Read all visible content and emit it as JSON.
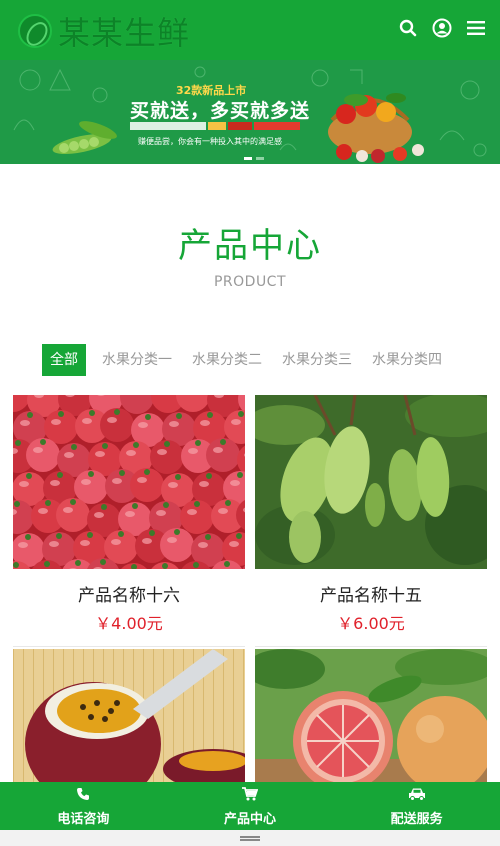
{
  "header": {
    "logo_text": "某某生鲜",
    "icons": [
      "search-icon",
      "user-icon",
      "menu-icon"
    ],
    "bg_color": "#16a637"
  },
  "banner": {
    "subtitle": "32款新品上市",
    "title": "买就送，多买就多送",
    "note": "赚便品尝，你会有一种投入其中的满足感"
  },
  "section": {
    "title": "产品中心",
    "subtitle": "PRODUCT"
  },
  "tabs": [
    {
      "label": "全部",
      "active": true
    },
    {
      "label": "水果分类一",
      "active": false
    },
    {
      "label": "水果分类二",
      "active": false
    },
    {
      "label": "水果分类三",
      "active": false
    },
    {
      "label": "水果分类四",
      "active": false
    }
  ],
  "products": [
    {
      "name": "产品名称十六",
      "price": "￥4.00元",
      "image": "tomatoes"
    },
    {
      "name": "产品名称十五",
      "price": "￥6.00元",
      "image": "mangoes"
    },
    {
      "image": "passion-fruit"
    },
    {
      "image": "grapefruit"
    }
  ],
  "bottom_nav": [
    {
      "label": "电话咨询",
      "icon": "phone-icon"
    },
    {
      "label": "产品中心",
      "icon": "cart-icon"
    },
    {
      "label": "配送服务",
      "icon": "car-icon"
    }
  ],
  "colors": {
    "accent": "#16a637",
    "price": "#e0212b",
    "muted": "#999999"
  }
}
